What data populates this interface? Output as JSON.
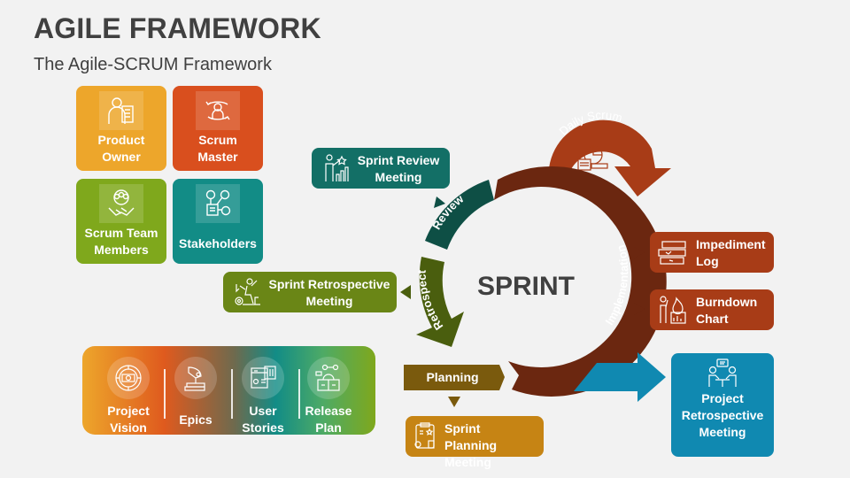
{
  "header": {
    "title": "AGILE FRAMEWORK",
    "subtitle": "The Agile-SCRUM Framework"
  },
  "roles": [
    {
      "label": "Product Owner",
      "line1": "Product",
      "line2": "Owner",
      "icon": "product-owner-icon",
      "color": "#eda62b"
    },
    {
      "label": "Scrum Master",
      "line1": "Scrum",
      "line2": "Master",
      "icon": "scrum-master-icon",
      "color": "#d94f1e"
    },
    {
      "label": "Scrum Team Members",
      "line1": "Scrum Team",
      "line2": "Members",
      "icon": "team-handshake-icon",
      "color": "#7fa81c"
    },
    {
      "label": "Stakeholders",
      "line1": "Stakeholders",
      "line2": "",
      "icon": "stakeholders-network-icon",
      "color": "#128c86"
    }
  ],
  "meetings": {
    "sprint_review": {
      "line1": "Sprint Review",
      "line2": "Meeting",
      "color": "#136f66"
    },
    "sprint_retrospective": {
      "line1": "Sprint Retrospective",
      "line2": "Meeting",
      "color": "#6a8616"
    },
    "sprint_planning": {
      "line1": "Sprint",
      "line2": "Planning",
      "line3": "Meeting",
      "color": "#c68414"
    },
    "project_retrospective": {
      "line1": "Project",
      "line2": "Retrospective",
      "line3": "Meeting",
      "color": "#1089b1"
    }
  },
  "sprint_cycle": {
    "center_label": "SPRINT",
    "phases": {
      "review": {
        "label": "Review",
        "color": "#0e4f45"
      },
      "retrospect": {
        "label": "Retrospect",
        "color": "#4a5e0e"
      },
      "planning": {
        "label": "Planning",
        "color": "#7a5a0d"
      },
      "implementation": {
        "label": "Implementation",
        "color": "#6b2710"
      },
      "daily_scrum": {
        "label": "Daily Scrum",
        "color": "#a83c17"
      }
    }
  },
  "implementation_outputs": [
    {
      "line1": "Impediment",
      "line2": "Log",
      "icon": "impediment-log-icon",
      "color": "#a83c17"
    },
    {
      "line1": "Burndown",
      "line2": "Chart",
      "icon": "burndown-chart-icon",
      "color": "#a83c17"
    }
  ],
  "artifacts": [
    {
      "line1": "Project",
      "line2": "Vision",
      "icon": "project-vision-icon"
    },
    {
      "line1": "Epics",
      "line2": "",
      "icon": "epics-icon"
    },
    {
      "line1": "User",
      "line2": "Stories",
      "icon": "user-stories-icon"
    },
    {
      "line1": "Release",
      "line2": "Plan",
      "icon": "release-plan-icon"
    }
  ],
  "colors": {
    "background": "#f2f2f2",
    "text_dark": "#404040",
    "flow_arrow": "#1089b1"
  }
}
